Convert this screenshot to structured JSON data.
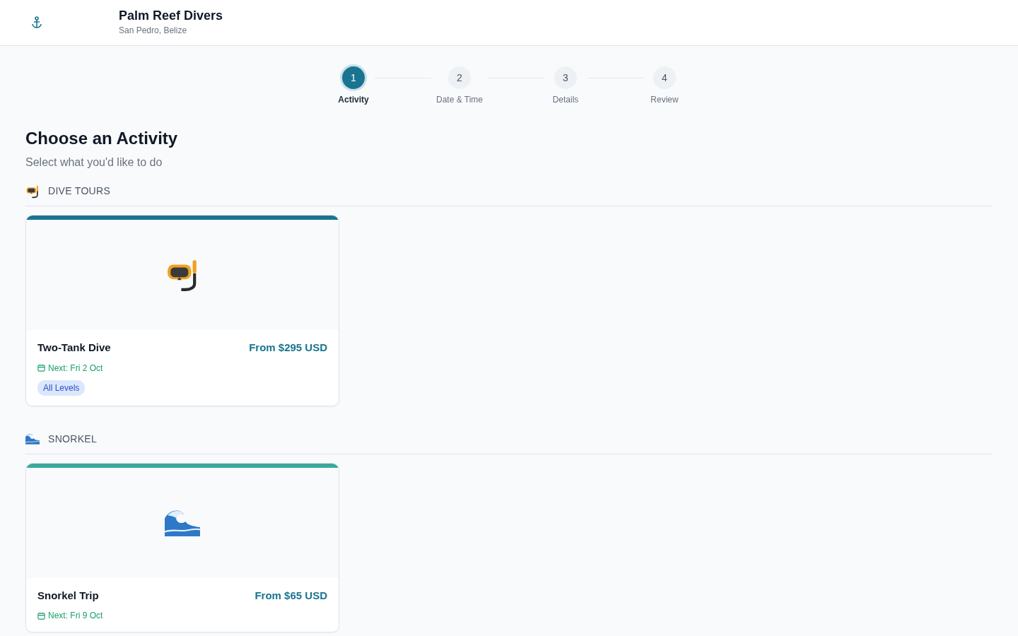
{
  "header": {
    "title": "Palm Reef Divers",
    "subtitle": "San Pedro, Belize"
  },
  "steps": [
    {
      "number": "1",
      "label": "Activity",
      "selected": true
    },
    {
      "number": "2",
      "label": "Date & Time",
      "selected": false
    },
    {
      "number": "3",
      "label": "Details",
      "selected": false
    },
    {
      "number": "4",
      "label": "Review",
      "selected": false
    }
  ],
  "heading": "Choose an Activity",
  "subheading": "Select what you'd like to do",
  "sections": [
    {
      "title": "DIVE TOURS",
      "kind": "mask",
      "color": "#1a7490",
      "activities": [
        {
          "name": "Two-Tank Dive",
          "price": "From $295 USD",
          "next": "Next: Fri 2 Oct",
          "level": "All Levels"
        }
      ]
    },
    {
      "title": "SNORKEL",
      "kind": "wave",
      "color": "#3aa89a",
      "activities": [
        {
          "name": "Snorkel Trip",
          "price": "From $65 USD",
          "next": "Next: Fri 9 Oct"
        }
      ]
    }
  ]
}
